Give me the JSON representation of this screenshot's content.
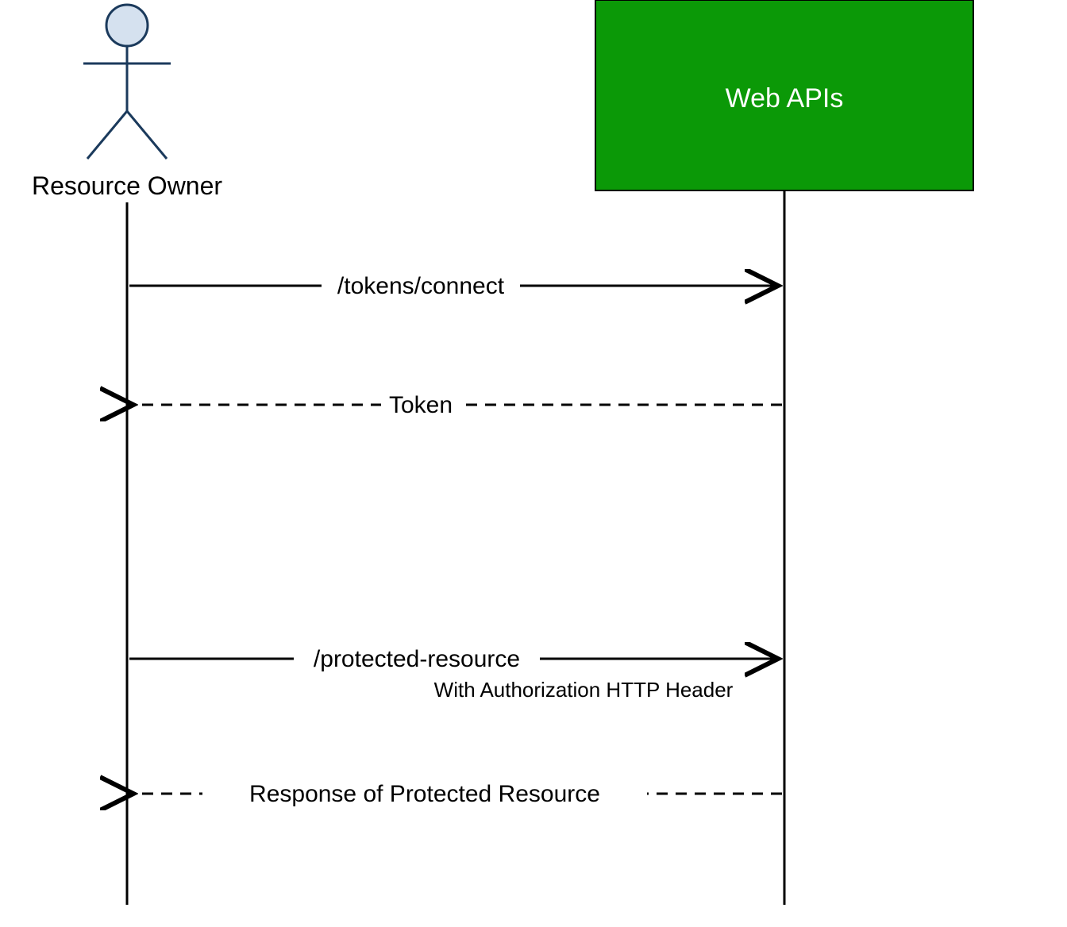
{
  "diagram": {
    "type": "sequence",
    "actor": {
      "label": "Resource Owner"
    },
    "participant": {
      "label": "Web APIs"
    },
    "messages": [
      {
        "label": "/tokens/connect",
        "direction": "request",
        "style": "solid"
      },
      {
        "label": "Token",
        "direction": "response",
        "style": "dashed"
      },
      {
        "label": "/protected-resource",
        "sublabel": "With Authorization HTTP Header",
        "direction": "request",
        "style": "solid"
      },
      {
        "label": "Response of Protected Resource",
        "direction": "response",
        "style": "dashed"
      }
    ],
    "colors": {
      "participantFill": "#0b9907",
      "actorStroke": "#1b3a5c",
      "actorHeadFill": "#d5e1ef"
    }
  }
}
